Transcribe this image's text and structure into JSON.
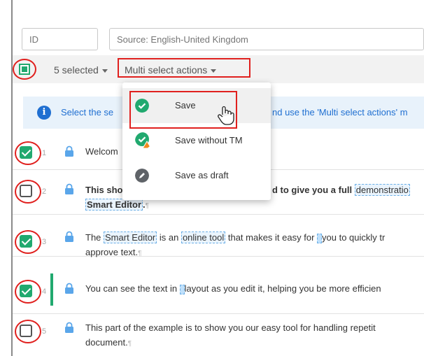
{
  "filters": {
    "id_placeholder": "ID",
    "source_placeholder": "Source: English-United Kingdom"
  },
  "toolbar": {
    "selected_count": "5 selected",
    "multi_select_label": "Multi select actions"
  },
  "info_bar": {
    "text_left": "Select the se",
    "text_right": "nd use the 'Multi select actions' m"
  },
  "menu": {
    "items": [
      {
        "label": "Save",
        "icon": "check-circle-icon"
      },
      {
        "label": "Save without TM",
        "icon": "check-warning-icon"
      },
      {
        "label": "Save as draft",
        "icon": "pencil-circle-icon"
      }
    ]
  },
  "segments": [
    {
      "num": "1",
      "checked": true,
      "text_a": "Welcom"
    },
    {
      "num": "2",
      "checked": false,
      "text_a": "This sho",
      "text_b": "d to give you a full ",
      "term_1": "demonstratio",
      "line2_term": "Smart Editor",
      "line2_end": "."
    },
    {
      "num": "3",
      "checked": true,
      "text_a": "The ",
      "term_1": "Smart Editor",
      "text_b": " is an ",
      "term_2": "online tool",
      "text_c": " that makes it easy for ",
      "text_d": "you to quickly tr",
      "line2": "approve text."
    },
    {
      "num": "4",
      "checked": true,
      "text_a": "You can see the text in ",
      "text_b": "layout as you edit it, helping you be more efficien"
    },
    {
      "num": "5",
      "checked": false,
      "text_a": "This part of the example is to show you our easy tool for handling repetit",
      "line2": "document."
    }
  ],
  "paragraph_mark": "¶",
  "colors": {
    "accent_green": "#21a96f",
    "annotation_red": "#e0201e",
    "info_blue": "#1f6fd1",
    "warning_orange": "#f28a1f"
  }
}
